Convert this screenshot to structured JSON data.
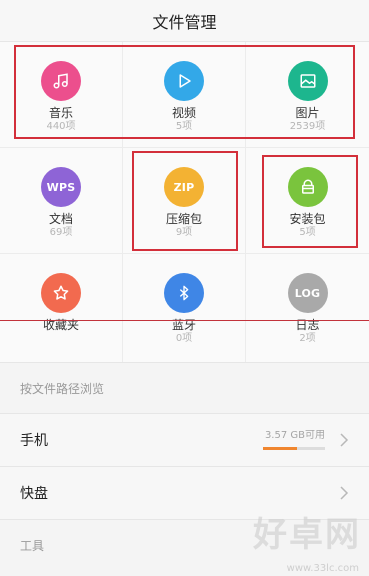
{
  "header": {
    "title": "文件管理"
  },
  "categories": [
    {
      "label": "音乐",
      "count": "440项",
      "icon": "music-note-icon",
      "color": "#ec4f8d",
      "text": ""
    },
    {
      "label": "视频",
      "count": "5项",
      "icon": "play-icon",
      "color": "#33a8e8",
      "text": ""
    },
    {
      "label": "图片",
      "count": "2539项",
      "icon": "image-icon",
      "color": "#1db68e",
      "text": ""
    },
    {
      "label": "文档",
      "count": "69项",
      "icon": "wps-icon",
      "color": "#8e64d6",
      "text": "WPS"
    },
    {
      "label": "压缩包",
      "count": "9项",
      "icon": "zip-icon",
      "color": "#f3b233",
      "text": "ZIP"
    },
    {
      "label": "安装包",
      "count": "5项",
      "icon": "package-icon",
      "color": "#7ac43d",
      "text": ""
    },
    {
      "label": "收藏夹",
      "count": "",
      "icon": "star-icon",
      "color": "#f26a4f",
      "text": ""
    },
    {
      "label": "蓝牙",
      "count": "0项",
      "icon": "bluetooth-icon",
      "color": "#3f86e6",
      "text": ""
    },
    {
      "label": "日志",
      "count": "2项",
      "icon": "log-icon",
      "color": "#a9a9a9",
      "text": "LOG"
    }
  ],
  "browse": {
    "title": "按文件路径浏览"
  },
  "list": {
    "phone": {
      "name": "手机",
      "storage_text": "3.57 GB可用",
      "used_fraction": 0.55
    },
    "kuaipan": {
      "name": "快盘"
    }
  },
  "tools": {
    "title": "工具"
  },
  "watermark": {
    "brand": "好卓网",
    "url": "www.33lc.com"
  },
  "colors": {
    "annotation": "#d32f3a",
    "storage_bar": "#f0862f"
  }
}
